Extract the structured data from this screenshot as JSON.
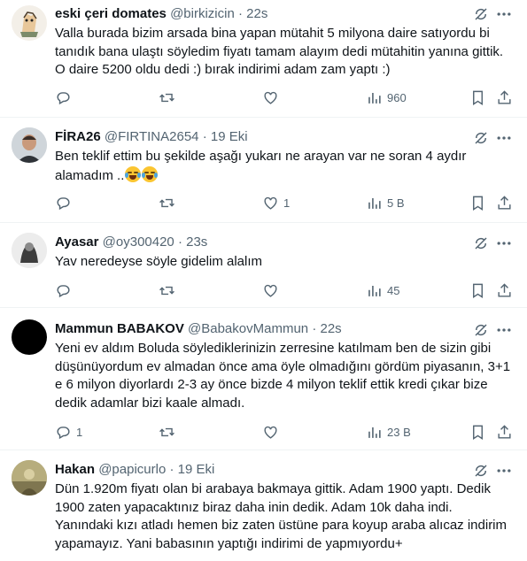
{
  "tweets": [
    {
      "name": "eski çeri domates",
      "handle": "@birkizicin",
      "time": "22s",
      "text": "Valla burada bizim arsada bina yapan mütahit 5 milyona daire satıyordu bi tanıdık bana ulaştı söyledim fiyatı tamam alayım dedi mütahitin yanına gittik. O daire 5200 oldu dedi :) bırak indirimi adam zam yaptı :)",
      "replies": "",
      "reposts": "",
      "likes": "",
      "views": "960"
    },
    {
      "name": "FİRA26",
      "handle": "@FIRTINA2654",
      "time": "19 Eki",
      "text": "Ben teklif ettim bu şekilde aşağı yukarı ne arayan var ne soran 4 aydır alamadım ..",
      "emoji": "face-with-tears-of-joy",
      "replies": "",
      "reposts": "",
      "likes": "1",
      "views": "5 B"
    },
    {
      "name": "Ayasar",
      "handle": "@oy300420",
      "time": "23s",
      "text": "Yav neredeyse söyle gidelim alalım",
      "replies": "",
      "reposts": "",
      "likes": "",
      "views": "45"
    },
    {
      "name": "Mammun BABAKOV",
      "handle": "@BabakovMammun",
      "time": "22s",
      "text": "Yeni ev aldım Boluda söylediklerinizin zerresine katılmam ben de sizin gibi düşünüyordum ev almadan önce ama öyle olmadığını gördüm piyasanın, 3+1 e 6 milyon diyorlardı 2-3 ay önce bizde 4 milyon teklif ettik kredi çıkar bize dedik adamlar bizi kaale almadı.",
      "replies": "1",
      "reposts": "",
      "likes": "",
      "views": "23 B"
    },
    {
      "name": "Hakan",
      "handle": "@papicurlo",
      "time": "19 Eki",
      "text": "Dün 1.920m fiyatı olan bi arabaya bakmaya gittik. Adam 1900 yaptı. Dedik 1900 zaten yapacaktınız biraz daha inin dedik. Adam 10k daha indi. Yanındaki kızı atladı hemen biz zaten üstüne para koyup araba alıcaz indirim yapamayız. Yani babasının yaptığı indirimi de yapmıyordu+",
      "replies": "",
      "reposts": "",
      "likes": "",
      "views": ""
    }
  ],
  "separator": "·",
  "icons": {
    "reply": "reply-icon",
    "repost": "repost-icon",
    "like": "heart-icon",
    "views": "views-icon",
    "bookmark": "bookmark-icon",
    "share": "share-icon",
    "grok": "grok-icon",
    "more": "more-icon"
  },
  "colors": {
    "text": "#0f1419",
    "secondary": "#536471",
    "divider": "#eff3f4"
  }
}
